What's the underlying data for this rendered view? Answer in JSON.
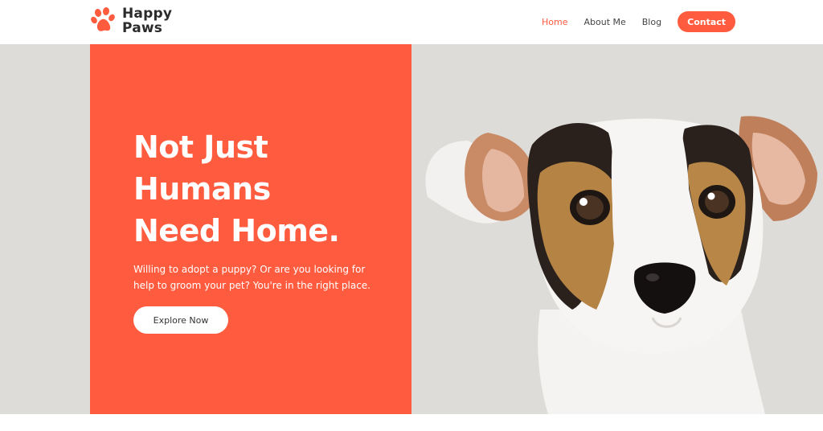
{
  "brand": {
    "line1": "Happy",
    "line2": "Paws",
    "logo_icon": "paw-icon",
    "accent_color": "#ff5b3e"
  },
  "nav": {
    "items": [
      {
        "label": "Home",
        "active": true
      },
      {
        "label": "About Me",
        "active": false
      },
      {
        "label": "Blog",
        "active": false
      }
    ],
    "contact_label": "Contact"
  },
  "hero": {
    "title_lines": [
      "Not Just",
      "Humans",
      "Need Home."
    ],
    "subtitle": "Willing to adopt a puppy? Or are you looking for help to groom your pet? You're in the right place.",
    "cta_label": "Explore Now",
    "panel_color": "#ff5b3e",
    "background_color": "#dedcd8",
    "image": "puppy-photo"
  }
}
